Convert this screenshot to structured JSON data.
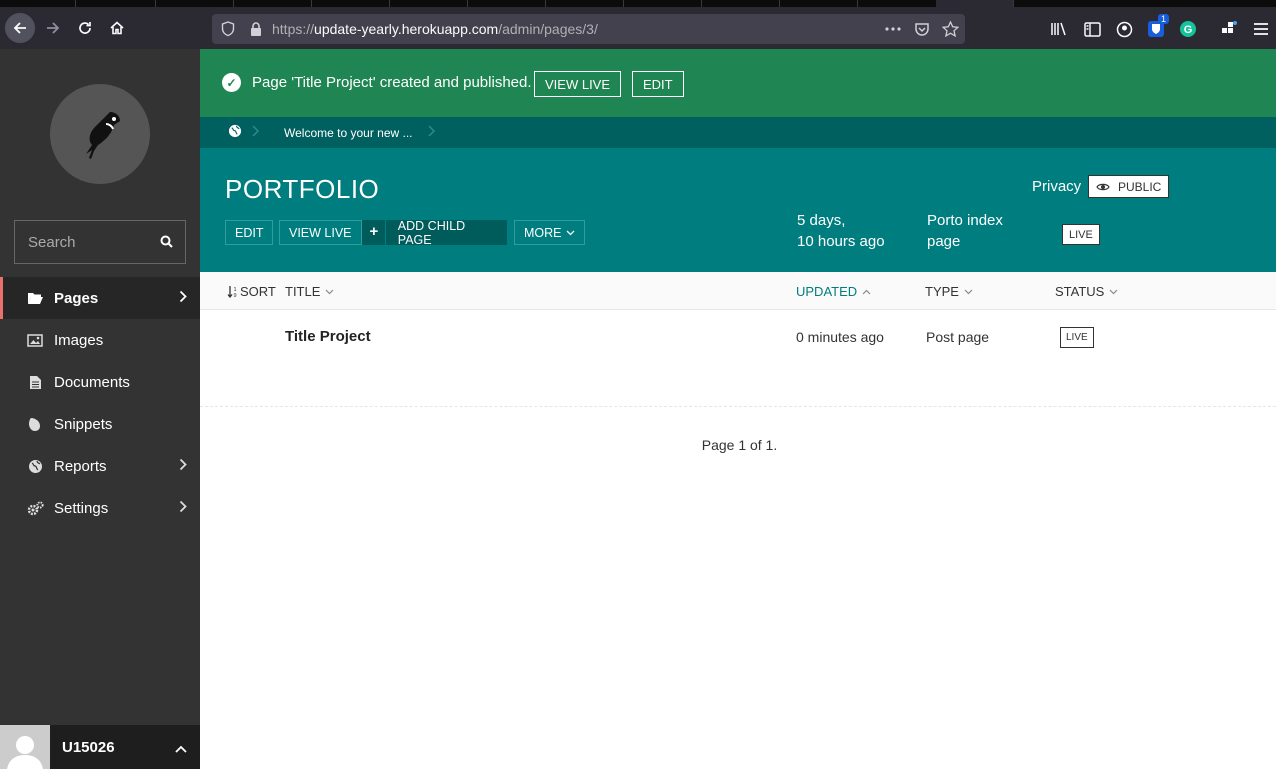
{
  "browser": {
    "url_prefix": "https://",
    "url_host": "update-yearly.herokuapp.com",
    "url_path": "/admin/pages/3/",
    "badge_count": "1"
  },
  "sidebar": {
    "search_placeholder": "Search",
    "items": [
      {
        "label": "Pages",
        "icon": "folder-open-icon"
      },
      {
        "label": "Images",
        "icon": "image-icon"
      },
      {
        "label": "Documents",
        "icon": "document-icon"
      },
      {
        "label": "Snippets",
        "icon": "snippet-icon"
      },
      {
        "label": "Reports",
        "icon": "globe-icon"
      },
      {
        "label": "Settings",
        "icon": "cogs-icon"
      }
    ],
    "user_name": "U15026"
  },
  "message": {
    "text": "Page 'Title Project' created and published.",
    "view_live": "VIEW LIVE",
    "edit": "EDIT"
  },
  "breadcrumb": {
    "label": "Welcome to your new ..."
  },
  "header": {
    "title": "PORTFOLIO",
    "buttons": {
      "edit": "EDIT",
      "view_live": "VIEW LIVE",
      "add_plus": "+",
      "add_child": "ADD CHILD PAGE",
      "more": "MORE"
    },
    "updated_line1": "5 days,",
    "updated_line2": "10 hours ago",
    "type_line1": "Porto index",
    "type_line2": "page",
    "status": "LIVE",
    "privacy_label": "Privacy",
    "privacy_value": "PUBLIC"
  },
  "listing": {
    "columns": {
      "sort": "SORT",
      "title": "TITLE",
      "updated": "UPDATED",
      "type": "TYPE",
      "status": "STATUS"
    },
    "rows": [
      {
        "title": "Title Project",
        "updated": "0 minutes ago",
        "type": "Post page",
        "status": "LIVE"
      }
    ],
    "pagination": "Page 1 of 1."
  },
  "colors": {
    "sidebar_bg": "#333333",
    "success_bg": "#1f8653",
    "breadcrumb_bg": "#006060",
    "header_bg": "#007d7e",
    "active_accent": "#e9b04d"
  }
}
